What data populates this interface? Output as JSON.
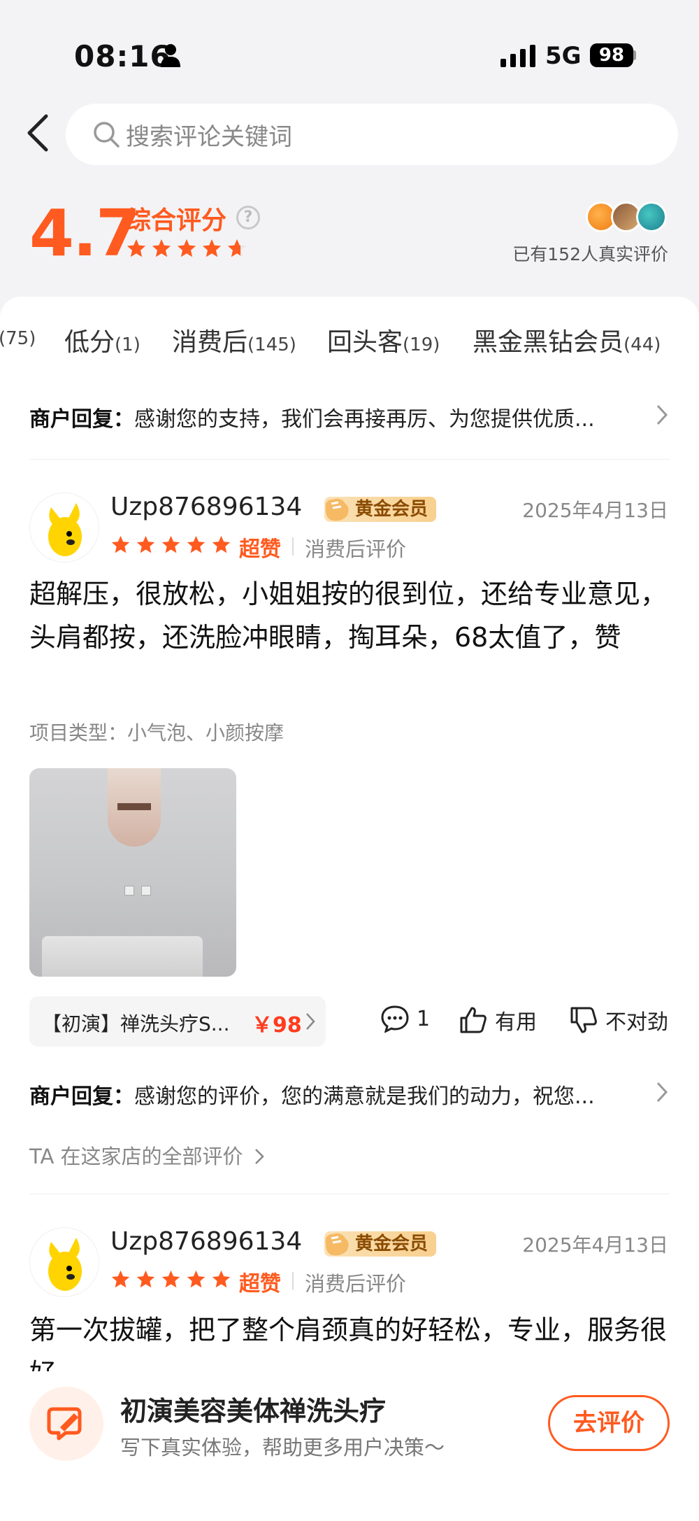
{
  "status_bar": {
    "time": "08:16",
    "network": "5G",
    "battery": "98"
  },
  "search": {
    "placeholder": "搜索评论关键词"
  },
  "summary": {
    "score": "4.7",
    "label": "综合评分",
    "rating": 4.7,
    "real_reviews": "已有152人真实评价"
  },
  "tabs": [
    {
      "label": "",
      "count": "(75)"
    },
    {
      "label": "低分",
      "count": "(1)"
    },
    {
      "label": "消费后",
      "count": "(145)"
    },
    {
      "label": "回头客",
      "count": "(19)"
    },
    {
      "label": "黑金黑钻会员",
      "count": "(44)"
    }
  ],
  "top_reply": {
    "prefix": "商户回复：",
    "text": "感谢您的支持，我们会再接再厉、为您提供优质..."
  },
  "reviews": [
    {
      "user": "Uzp876896134",
      "badge": "黄金会员",
      "date": "2025年4月13日",
      "rating": 5,
      "rating_label": "超赞",
      "review_type": "消费后评价",
      "text": "超解压，很放松，小姐姐按的很到位，还给专业意见，头肩都按，还洗脸冲眼睛，掏耳朵，68太值了，赞",
      "item_type": "项目类型：小气泡、小颜按摩",
      "product": {
        "name": "【初演】禅洗头疗S...",
        "price": "￥98"
      },
      "comments": "1",
      "useful_label": "有用",
      "not_right_label": "不对劲",
      "reply_prefix": "商户回复：",
      "reply_text": "感谢您的评价，您的满意就是我们的动力，祝您...",
      "all_reviews_link": "TA 在这家店的全部评价"
    },
    {
      "user": "Uzp876896134",
      "badge": "黄金会员",
      "date": "2025年4月13日",
      "rating": 5,
      "rating_label": "超赞",
      "review_type": "消费后评价",
      "text": "第一次拔罐，把了整个肩颈真的好轻松，专业，服务很好"
    }
  ],
  "footer": {
    "shop_name": "初演美容美体禅洗头疗",
    "subtitle": "写下真实体验，帮助更多用户决策～",
    "button": "去评价"
  },
  "colors": {
    "accent": "#ff5a1f",
    "price": "#ff3b1f",
    "badge_bg": "#f8d08f"
  }
}
